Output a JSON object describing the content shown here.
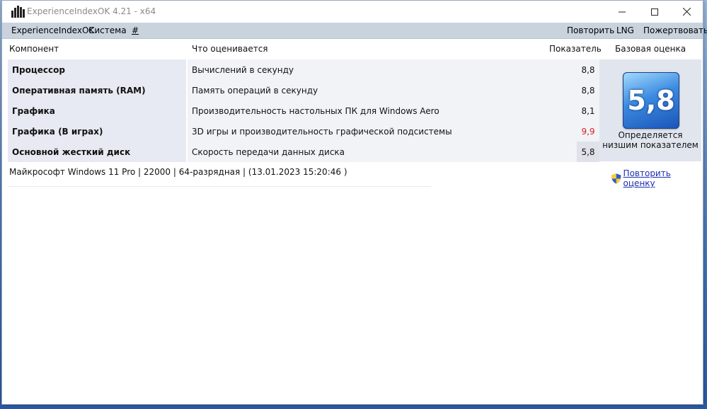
{
  "window": {
    "title": "ExperienceIndexOK 4.21 - x64"
  },
  "menu": {
    "left": [
      "ExperienceIndexOK",
      "Система",
      "#"
    ],
    "right": [
      "Повторить",
      "LNG",
      "Пожертвовать"
    ]
  },
  "table": {
    "headers": {
      "component": "Компонент",
      "rated": "Что оценивается",
      "score": "Показатель",
      "base": "Базовая оценка"
    },
    "rows": [
      {
        "name": "Процессор",
        "desc": "Вычислений в секунду",
        "score": "8,8"
      },
      {
        "name": "Оперативная память (RAM)",
        "desc": "Память операций в секунду",
        "score": "8,8"
      },
      {
        "name": "Графика",
        "desc": "Производительность настольных ПК для Windows Aero",
        "score": "8,1"
      },
      {
        "name": "Графика (В играх)",
        "desc": "3D игры и производительность графической подсистемы",
        "score": "9,9"
      },
      {
        "name": "Основной жесткий диск",
        "desc": "Скорость передачи данных диска",
        "score": "5,8"
      }
    ]
  },
  "base": {
    "score": "5,8",
    "note": "Определяется низшим показателем"
  },
  "status": "Майкрософт Windows 11 Pro | 22000 | 64-разрядная | (13.01.2023 15:20:46 )",
  "rerate_link": "Повторить оценку",
  "colors": {
    "menu_bg": "#c9d3de",
    "highest_score": "#d42020",
    "link": "#1b2fb0"
  }
}
